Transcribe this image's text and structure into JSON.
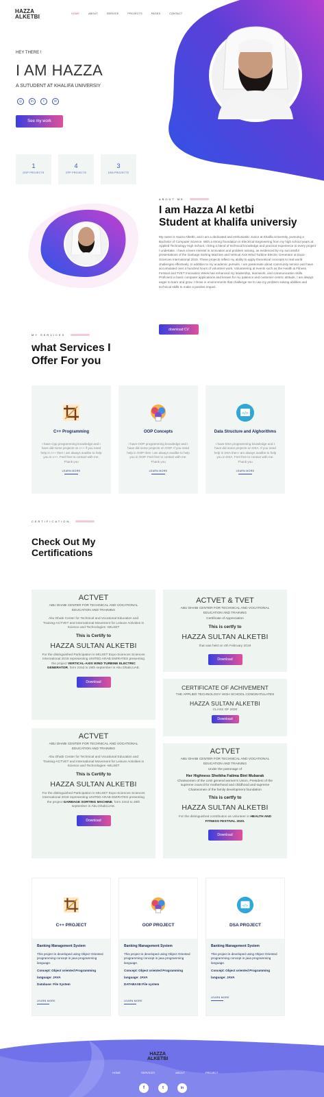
{
  "header": {
    "logo": [
      "HAZZA",
      "ALKETBI"
    ],
    "nav": [
      "HOME",
      "ABOUT",
      "SERVICE",
      "PROJECTS",
      "PAGES",
      "CONTACT"
    ]
  },
  "hero": {
    "greeting": "HEY THERE !",
    "name": "I AM HAZZA",
    "subtitle": "A SUTUDENT AT KHALIFA UNIVERSIY",
    "socials": [
      "github-icon",
      "linkedin-icon",
      "twitter-icon",
      "email-icon"
    ],
    "cta": "See my work",
    "stats": [
      {
        "value": "1",
        "label": "OOP PROJECTS"
      },
      {
        "value": "4",
        "label": "CPP PROJECTS"
      },
      {
        "value": "3",
        "label": "DSA PROJECTS"
      }
    ]
  },
  "about": {
    "label": "ABOUT ME",
    "title_line1": "I am Hazza Al ketbi",
    "title_line2": "Student at khalifa universiy",
    "text": "My name is Hazza Alketbi, and I am a dedicated and enthusiastic Junior at Khalifa University, pursuing a Bachelor of Computer Science. With a strong foundation in Electrical Engineering from my high school years at Applied Technology High School, I bring a blend of technical knowledge and practical experience to every project I undertake. I have a keen interest in innovation and problem solving, as evidenced by my successful presentations of the Garbage Sorting Machine and Vertical Axis Wind Turbine Electric Generator at Expo-Sciences International 2019. These projects reflect my ability to apply theoretical concepts to real world challenges effectively. In addition to my academic pursuits, I am passionate about community service and have accumulated over a hundred hours of volunteer work. Volunteering at events such as the Health & Fitness Festival and TVET Innovation Week has enhanced my leadership, teamwork, and communication skills. Proficient in basic computer applications and known for my patience and customer-centric attitude, I am always eager to learn and grow. I thrive in environments that challenge me to use my problem solving abilities and technical skills to make a positive impact.",
    "cta": "download CV"
  },
  "services": {
    "label": "MY SERVICES",
    "title_line1": "what Services I",
    "title_line2": "Offer For you",
    "items": [
      {
        "icon": "crop-icon",
        "title": "C++ Programming",
        "text": "I have Cpp programming knowledge and I have did some projects on c++ if you need help in c++ then I am always availbe to help you in c++. Feel free to contact with me. Thank you",
        "link": "LEARN MORE"
      },
      {
        "icon": "palette-icon",
        "title": "OOP Concepts",
        "text": "I have OOP programming knowledge and I have did some projects on OOP. If you need help in OOP then I am always availbe to help you in OOP. Feel free to contact with me. Thank you",
        "link": "LEARN MORE"
      },
      {
        "icon": "code-icon",
        "title": "Data Structure and Alghorithms",
        "text": "I have DSA programming knowledge and I have did some projects on DSA. If you need help in DSA then I am always availbe to help you in DSA. Feel free to contact with me. Thank you",
        "link": "LEARN MORE"
      }
    ]
  },
  "certs": {
    "label": "CERTIFICATION",
    "title_line1": "Check Out My",
    "title_line2": "Certifications",
    "c1": {
      "head": "ACTVET",
      "org": "ABU DHABI CENTER FOR TECHNICAL AND VOCATIONAL EDUCATION AND TRAINING",
      "small": "Abu Dhabi Center for Technical and Vocational Education and Training-ACTVET and International Movement for Leisure Activities in Science and Technologies -MILSET",
      "certify": "This is Certify to",
      "name": "HAZZA SULTAN ALKETBI",
      "desc_a": "For the distinguished Participation in MILSET Expo-Sciences Sciences International 2019 representing UNITED ARAB EMIRATES presenting the project",
      "desc_b": "VERTICAL-AXIS WIND TURBINE ELECTRIC GENERATOR",
      "desc_c": ", form 22nd to 28th september in Abu Dhabi,UAE.",
      "btn": "Download"
    },
    "c2": {
      "head": "ACTVET & TVET",
      "org": "ABU DHABI CENTER FOR TECHNICAL AND VOCATIONAL EDUCATION AND TRAINING",
      "small": "Certificate of Appreciation",
      "certify": "This is certfy to",
      "name": "HAZZA SULTAN ALKETBI",
      "desc": "that was held on 4th February 2019",
      "btn": "Download"
    },
    "c3": {
      "head": "CERTIFICATE OF ACHIVEMENT",
      "org": "THE APPLIED TECHNOLOGY HIGH SCHOOL CONGRATULATES",
      "name": "HAZZA SULTAN ALKETBI",
      "desc": "CLASS OF 2020",
      "btn": "Download"
    },
    "c4": {
      "head": "ACTVET",
      "org": "ABU DHABI CENTER FOR TECHNICAL AND VOCATIONAL EDUCATION AND TRAINING",
      "small": "Abu Dhabi Center for Technical and Vocational Education and Training-ACTVET and International Movement for Leisure Activities in Science and Technologies -MILSET",
      "certify": "This is Certify to",
      "name": "HAZZA SULTAN ALKETBI",
      "desc_a": "For the distinguished Participation in MILSET Expo-Sciences Sciences International 2019 representing UNITED ARAB EMIRATES presenting the project",
      "desc_b": "GARBAGE SORTING MACHINE",
      "desc_c": ", form 22nd to 28th september in Abu Dhabi,UAE.",
      "btn": "Download"
    },
    "c5": {
      "head": "ACTVET",
      "org": "ABU DHABI CENTER FOR TECHNICAL AND VOCATIONAL EDUCATION AND TRAINING",
      "small": "Under the patronage of",
      "patron": "Her Highness Sheikha Fatima Bint Mubarak",
      "patron_desc": "Chairwomen of the UAE general women's Union, President of the supreme council for motherhood and childhood and supreme Chairwomen of the family development foundation",
      "certify": "This is certfy to",
      "name": "HAZZA SULTAN ALKETBI",
      "desc_a": "For the distinguished contribution as volunteer in",
      "desc_b": "HEALTH AND FITNESS FESTIVAL 2020.",
      "btn": "Download"
    }
  },
  "projects": [
    {
      "icon": "crop-icon",
      "title": "C++ PROJECT",
      "name": "Banking Management System",
      "text": "This project is developed using Object Oriented programming concept in java programming language.",
      "k1": "Concept: Object oriented Programming",
      "k2": "language: JAVA",
      "k3": "Database: File System",
      "link": "LEARN MORE"
    },
    {
      "icon": "palette-icon",
      "title": "OOP PROJECT",
      "name": "Banking Management System",
      "text": "This project is developed using Object Oriented programming concept in java programming language.",
      "k1": "Concept: Object oriented Programming",
      "k2": "language: JAVA",
      "k3": "DATABASE:File system",
      "link": "LEARN MORE"
    },
    {
      "icon": "code-icon",
      "title": "DSA PROJECT",
      "name": "Banking Management System",
      "text": "This project is developed using Object Oriented programming concept in java programming language.",
      "k1": "Concept: Object oriented Programming",
      "k2": "language: JAVA",
      "k3": "",
      "link": "LEARN MORE"
    }
  ],
  "footer": {
    "logo": [
      "HAZZA",
      "ALKETBI"
    ],
    "nav": [
      "HOME",
      "SERVICES",
      "ABOUT",
      "PROJECT"
    ],
    "socials": [
      "f",
      "t",
      "in"
    ]
  },
  "colors": {
    "accent_blue": "#3a3ee0",
    "accent_pink": "#e0509a",
    "card_bg": "#f1f6f4"
  }
}
